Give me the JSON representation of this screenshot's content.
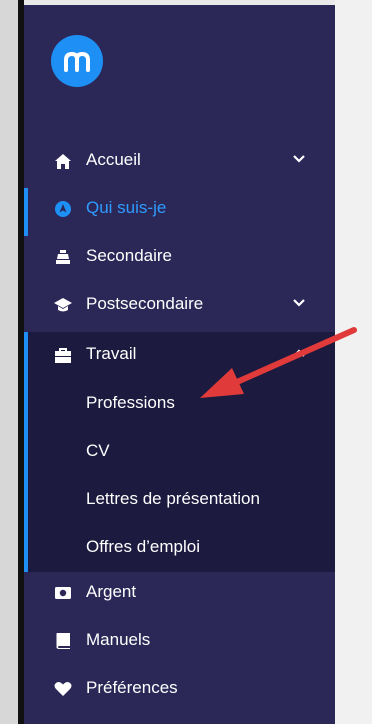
{
  "sidebar": {
    "items": [
      {
        "label": "Accueil",
        "icon": "home-icon",
        "has_chevron": true
      },
      {
        "label": "Qui suis-je",
        "icon": "compass-icon",
        "active": true
      },
      {
        "label": "Secondaire",
        "icon": "school-icon"
      },
      {
        "label": "Postsecondaire",
        "icon": "graduation-cap-icon",
        "has_chevron": true
      },
      {
        "label": "Travail",
        "icon": "briefcase-icon",
        "expanded": true
      },
      {
        "label": "Argent",
        "icon": "money-icon"
      },
      {
        "label": "Manuels",
        "icon": "book-icon"
      },
      {
        "label": "Préférences",
        "icon": "heart-icon"
      }
    ],
    "travail_submenu": [
      {
        "label": "Professions"
      },
      {
        "label": "CV"
      },
      {
        "label": "Lettres de présentation"
      },
      {
        "label": "Offres d’emploi"
      }
    ]
  },
  "colors": {
    "sidebar_bg": "#2b2857",
    "submenu_bg": "#1c1a3e",
    "accent": "#1e90f5",
    "annotation_arrow": "#e03a3a"
  }
}
